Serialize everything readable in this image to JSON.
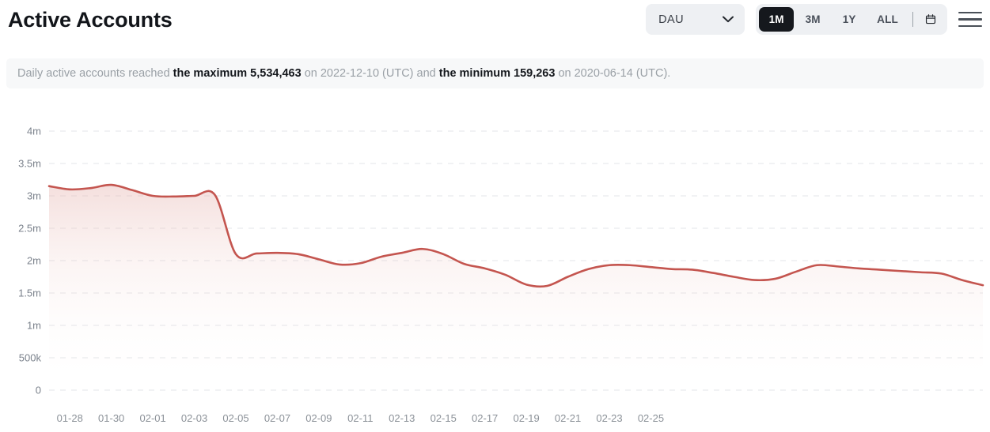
{
  "header": {
    "title": "Active Accounts",
    "metric_select": {
      "value": "DAU",
      "icon": "chevron-down-icon"
    },
    "ranges": [
      {
        "label": "1M",
        "active": true
      },
      {
        "label": "3M",
        "active": false
      },
      {
        "label": "1Y",
        "active": false
      },
      {
        "label": "ALL",
        "active": false
      }
    ],
    "calendar_icon": "calendar-icon",
    "menu_icon": "hamburger-menu-icon"
  },
  "summary": {
    "prefix": "Daily active accounts reached ",
    "max_label": "the maximum 5,534,463",
    "max_value": "5,534,463",
    "mid": " on 2022-12-10 (UTC) and ",
    "max_date": "2022-12-10 (UTC)",
    "min_label": "the minimum 159,263",
    "min_value": "159,263",
    "suffix": " on 2020-06-14 (UTC).",
    "min_date": "2020-06-14 (UTC)"
  },
  "colors": {
    "line": "#c4554f",
    "area_top": "#f8e9e8",
    "area_bottom": "#ffffff",
    "grid": "#e3e5e8",
    "accent_active": "#15181d",
    "control_bg": "#eef0f3",
    "banner_bg": "#f7f8f9"
  },
  "chart_data": {
    "type": "line",
    "title": "Active Accounts",
    "xlabel": "",
    "ylabel": "",
    "ylim": [
      0,
      4000000
    ],
    "grid": true,
    "legend": "none",
    "y_ticks": [
      0,
      500000,
      1000000,
      1500000,
      2000000,
      2500000,
      3000000,
      3500000,
      4000000
    ],
    "y_tick_labels": [
      "0",
      "500k",
      "1m",
      "1.5m",
      "2m",
      "2.5m",
      "3m",
      "3.5m",
      "4m"
    ],
    "x_tick_labels": [
      "01-28",
      "01-30",
      "02-01",
      "02-03",
      "02-05",
      "02-07",
      "02-09",
      "02-11",
      "02-13",
      "02-15",
      "02-17",
      "02-19",
      "02-21",
      "02-23",
      "02-25"
    ],
    "x": [
      "01-27",
      "01-28",
      "01-29",
      "01-30",
      "01-31",
      "02-01",
      "02-02",
      "02-03",
      "02-04",
      "02-05",
      "02-06",
      "02-07",
      "02-08",
      "02-09",
      "02-10",
      "02-11",
      "02-12",
      "02-13",
      "02-14",
      "02-15",
      "02-16",
      "02-17",
      "02-18",
      "02-19",
      "02-20",
      "02-21",
      "02-22",
      "02-23",
      "02-24",
      "02-25",
      "02-26"
    ],
    "series": [
      {
        "name": "Daily Active Accounts",
        "values": [
          3150000,
          3100000,
          3120000,
          3170000,
          3090000,
          3000000,
          2990000,
          3000000,
          3010000,
          2100000,
          2110000,
          2120000,
          2100000,
          2020000,
          1940000,
          1960000,
          2060000,
          2120000,
          2180000,
          2100000,
          1950000,
          1880000,
          1780000,
          1630000,
          1610000,
          1750000,
          1870000,
          1930000,
          1930000,
          1900000,
          1870000,
          1860000,
          1810000,
          1750000,
          1700000,
          1720000,
          1830000,
          1930000,
          1910000,
          1880000,
          1860000,
          1840000,
          1820000,
          1800000,
          1700000,
          1620000
        ]
      }
    ]
  }
}
